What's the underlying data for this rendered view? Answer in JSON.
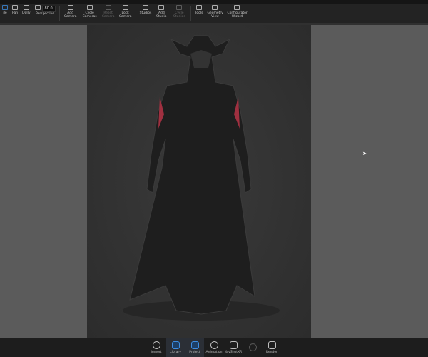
{
  "toolbar": {
    "items": [
      {
        "label": "ile",
        "icon": "file-icon"
      },
      {
        "label": "Pan",
        "icon": "pan-icon"
      },
      {
        "label": "Dolly",
        "icon": "dolly-icon"
      },
      {
        "label": "Perspective",
        "icon": "perspective-icon"
      },
      {
        "label": "Add Camera",
        "icon": "add-camera-icon"
      },
      {
        "label": "Cycle Cameras",
        "icon": "cycle-cameras-icon"
      },
      {
        "label": "Reset Camera",
        "icon": "reset-camera-icon",
        "disabled": true
      },
      {
        "label": "Lock Camera",
        "icon": "lock-camera-icon"
      },
      {
        "label": "Studios",
        "icon": "studios-icon"
      },
      {
        "label": "Add Studio",
        "icon": "add-studio-icon"
      },
      {
        "label": "Cycle Studios",
        "icon": "cycle-studios-icon",
        "disabled": true
      },
      {
        "label": "Tools",
        "icon": "tools-icon"
      },
      {
        "label": "Geometry View",
        "icon": "geometry-view-icon"
      },
      {
        "label": "Configurator Wizard",
        "icon": "configurator-wizard-icon"
      }
    ],
    "perspective_value": "80.0"
  },
  "bottombar": {
    "items": [
      {
        "label": "Import",
        "icon": "import-icon"
      },
      {
        "label": "Library",
        "icon": "library-icon",
        "active": true
      },
      {
        "label": "Project",
        "icon": "project-icon",
        "active": true
      },
      {
        "label": "Animation",
        "icon": "animation-icon"
      },
      {
        "label": "KeyShotXR",
        "icon": "keyshotxr-icon"
      },
      {
        "label": "",
        "icon": "disabled-icon",
        "disabled": true
      },
      {
        "label": "Render",
        "icon": "render-icon"
      }
    ]
  },
  "colors": {
    "accent": "#3c8ce0",
    "viewport_bg": "#5b5b5b",
    "render_bg": "#2e2e2e"
  }
}
